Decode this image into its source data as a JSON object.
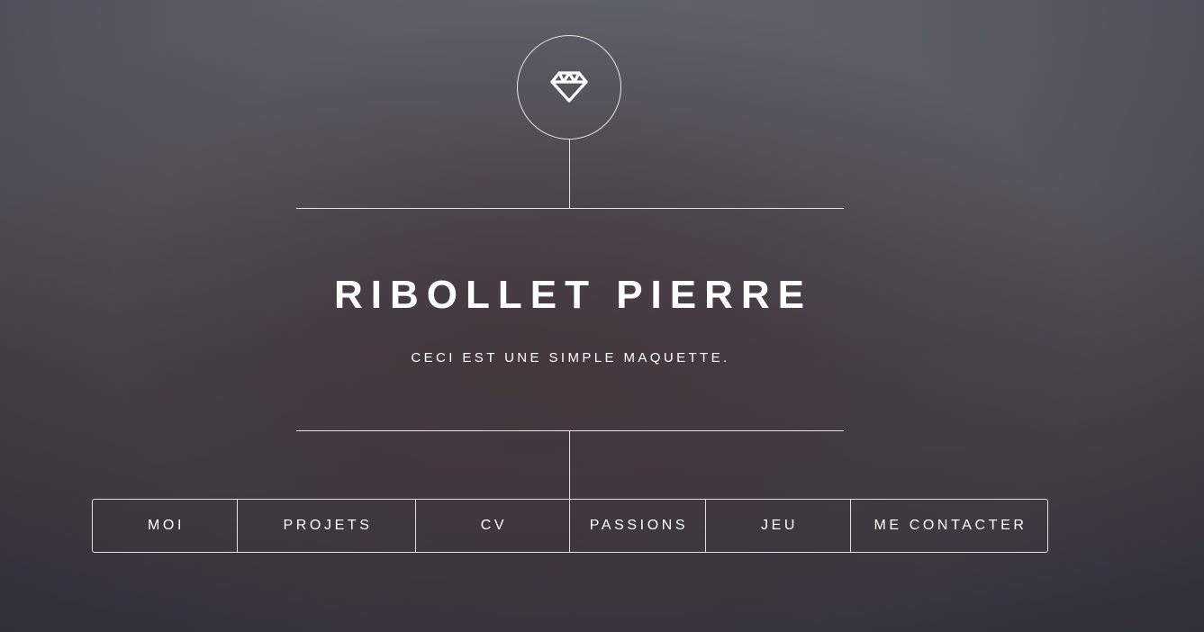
{
  "header": {
    "logo_icon": "diamond-icon",
    "title": "RIBOLLET PIERRE",
    "subtitle": "CECI EST UNE SIMPLE MAQUETTE."
  },
  "nav": {
    "items": [
      {
        "label": "MOI"
      },
      {
        "label": "PROJETS"
      },
      {
        "label": "CV"
      },
      {
        "label": "PASSIONS"
      },
      {
        "label": "JEU"
      },
      {
        "label": "ME CONTACTER"
      }
    ]
  },
  "colors": {
    "line": "#ffffff",
    "text": "#ffffff",
    "background_top": "#5f616b",
    "background_bottom": "#36353f"
  }
}
